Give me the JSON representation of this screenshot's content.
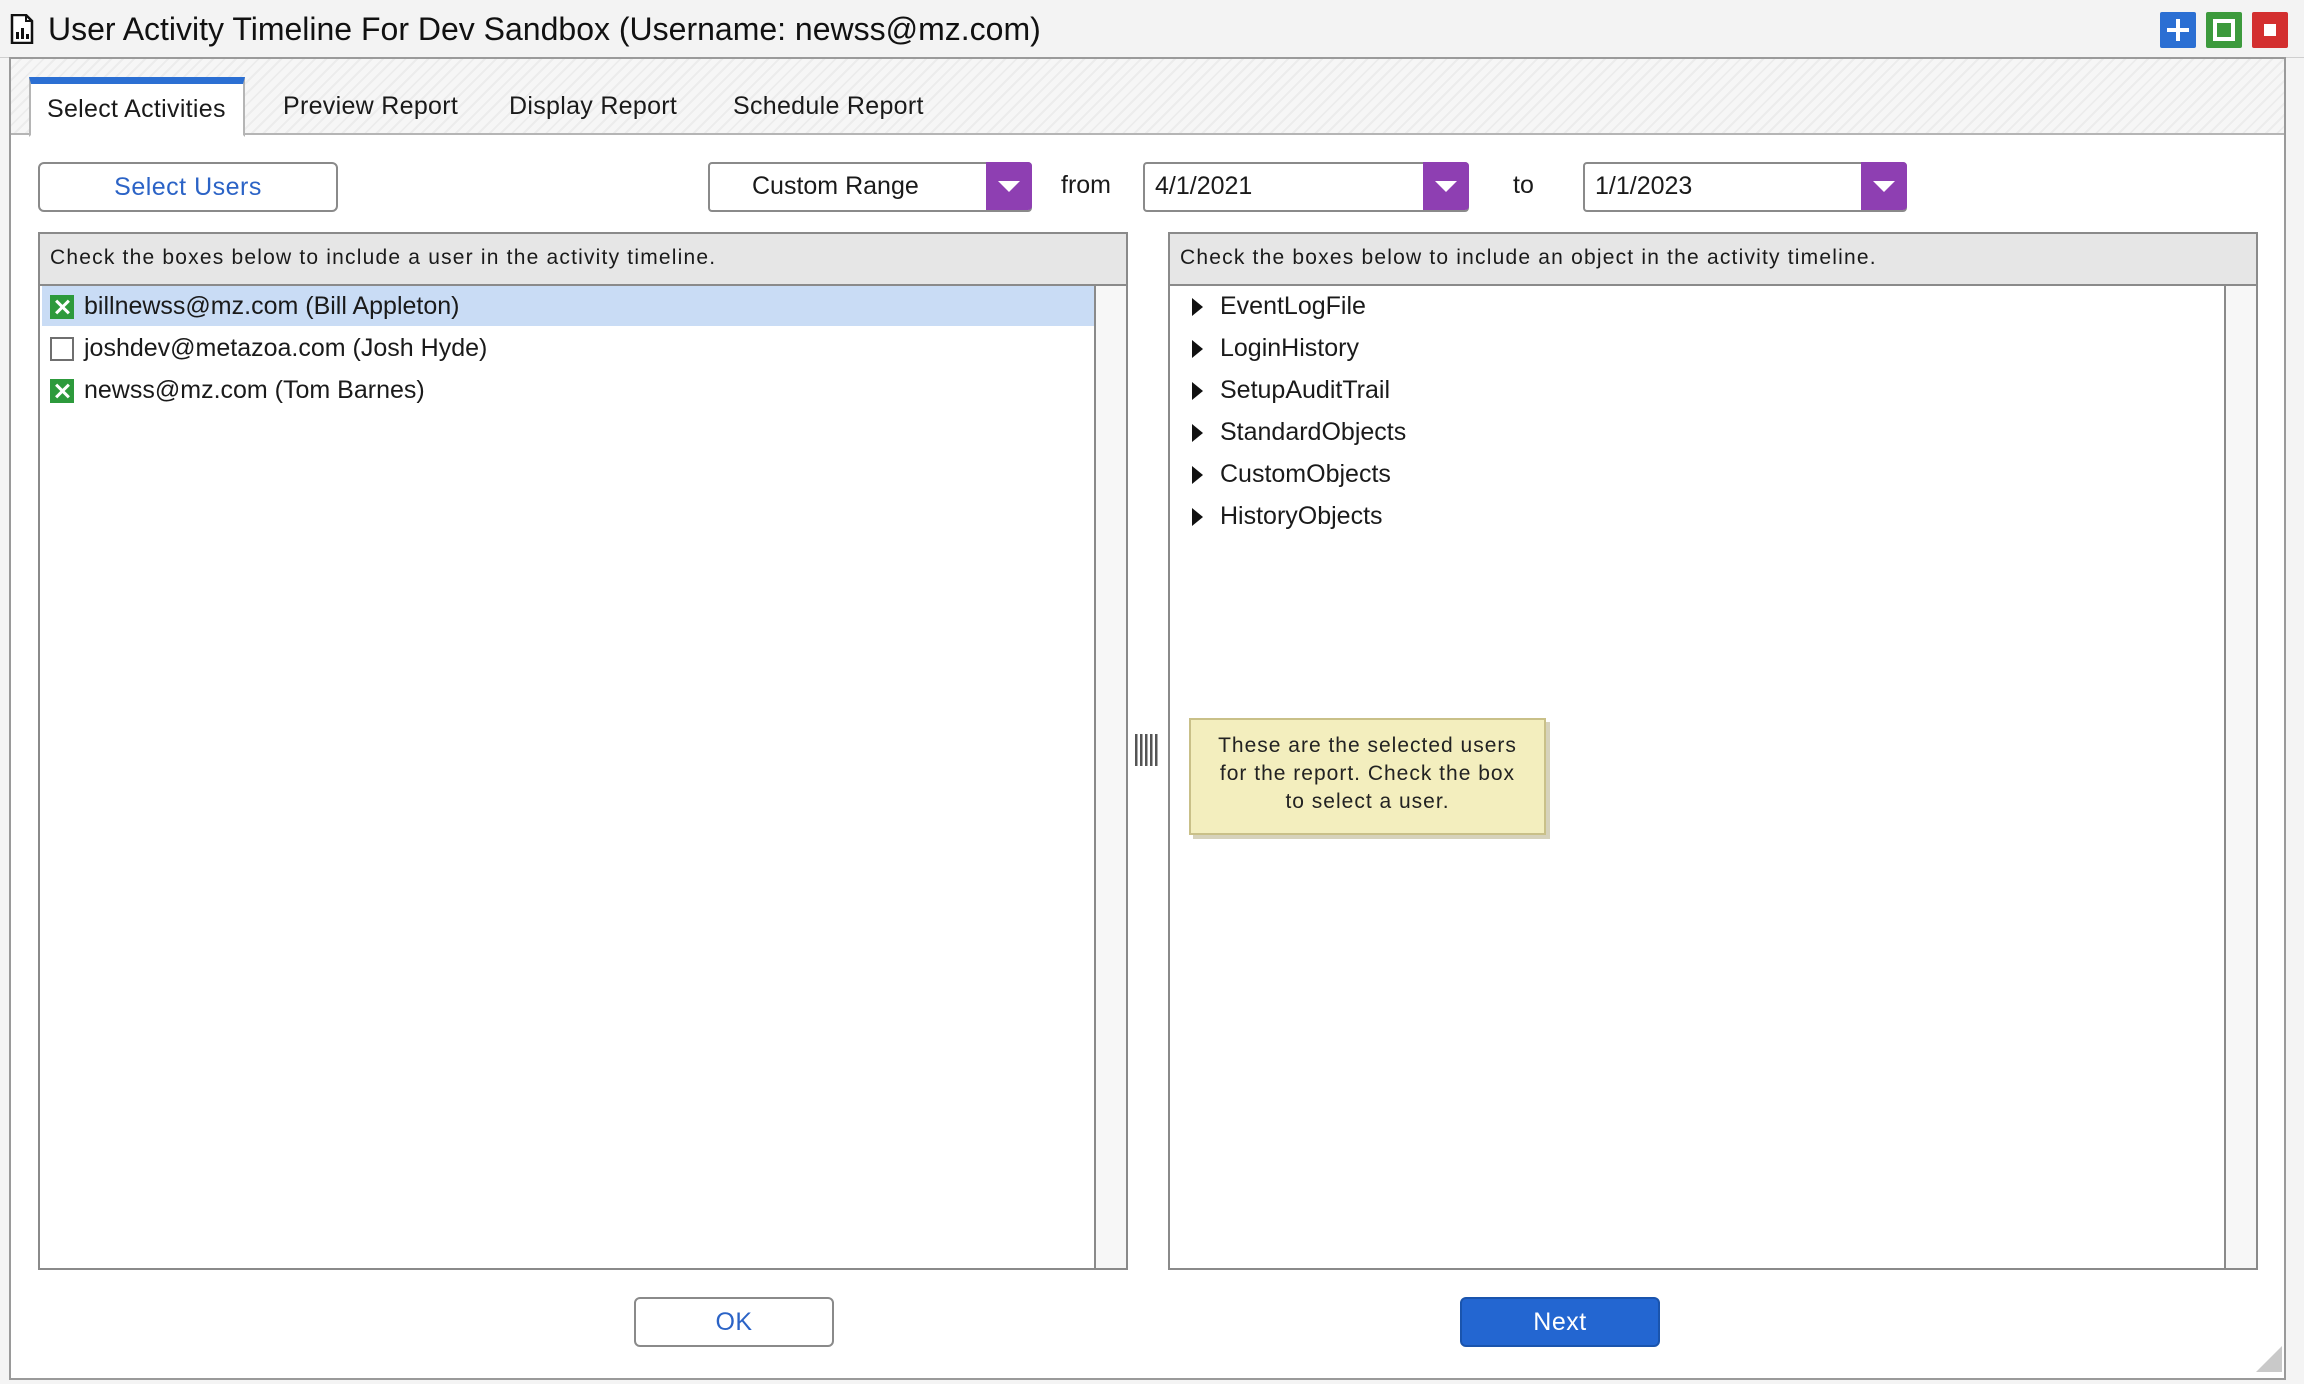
{
  "window": {
    "title": "User Activity Timeline For Dev Sandbox (Username: newss@mz.com)",
    "title_icon": "report-icon",
    "controls": [
      {
        "name": "add-window-button",
        "icon": "plus-icon",
        "color": "#2b6fd3"
      },
      {
        "name": "maximize-button",
        "icon": "square-icon",
        "color": "#3c9a3c"
      },
      {
        "name": "close-button",
        "icon": "stop-icon",
        "color": "#d32f2f"
      }
    ]
  },
  "tabs": [
    {
      "label": "Select Activities",
      "active": true
    },
    {
      "label": "Preview Report",
      "active": false
    },
    {
      "label": "Display Report",
      "active": false
    },
    {
      "label": "Schedule Report",
      "active": false
    }
  ],
  "toolbar": {
    "select_users_label": "Select Users",
    "range_value": "Custom Range",
    "from_label": "from",
    "from_date": "4/1/2021",
    "to_label": "to",
    "to_date": "1/1/2023",
    "accent": "#8e3fb2"
  },
  "users_panel": {
    "header": "Check the boxes below to include a user in the activity timeline.",
    "users": [
      {
        "label": "billnewss@mz.com (Bill Appleton)",
        "checked": true,
        "selected": true
      },
      {
        "label": "joshdev@metazoa.com (Josh Hyde)",
        "checked": false,
        "selected": false
      },
      {
        "label": "newss@mz.com (Tom Barnes)",
        "checked": true,
        "selected": false
      }
    ]
  },
  "objects_panel": {
    "header": "Check the boxes below to include an object in the activity timeline.",
    "objects": [
      "EventLogFile",
      "LoginHistory",
      "SetupAuditTrail",
      "StandardObjects",
      "CustomObjects",
      "HistoryObjects"
    ]
  },
  "tooltip": {
    "lines": [
      "These are the selected users",
      "for the report. Check the box",
      "to select a user."
    ]
  },
  "footer": {
    "ok_label": "OK",
    "next_label": "Next",
    "next_color": "#2366d1"
  }
}
